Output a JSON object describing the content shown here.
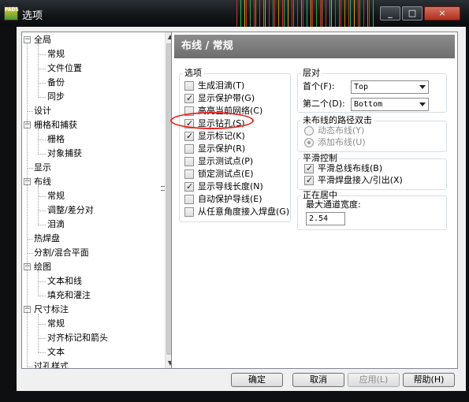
{
  "window": {
    "title": "选项",
    "app_icon_text": "PADS"
  },
  "title_buttons": {
    "minimize": "_",
    "maximize": "□",
    "close": "×"
  },
  "colors": {
    "highlight_circle": "#e8231d",
    "panel_header": "#7d7d7d"
  },
  "tree": {
    "items": [
      {
        "label": "全局",
        "level": 0,
        "expander": "minus"
      },
      {
        "label": "常规",
        "level": 1
      },
      {
        "label": "文件位置",
        "level": 1
      },
      {
        "label": "备份",
        "level": 1
      },
      {
        "label": "同步",
        "level": 1
      },
      {
        "label": "设计",
        "level": 0
      },
      {
        "label": "栅格和捕获",
        "level": 0,
        "expander": "minus"
      },
      {
        "label": "栅格",
        "level": 1
      },
      {
        "label": "对象捕获",
        "level": 1
      },
      {
        "label": "显示",
        "level": 0
      },
      {
        "label": "布线",
        "level": 0,
        "expander": "minus"
      },
      {
        "label": "常规",
        "level": 1
      },
      {
        "label": "调整/差分对",
        "level": 1
      },
      {
        "label": "泪滴",
        "level": 1
      },
      {
        "label": "热焊盘",
        "level": 0
      },
      {
        "label": "分割/混合平面",
        "level": 0
      },
      {
        "label": "绘图",
        "level": 0,
        "expander": "minus"
      },
      {
        "label": "文本和线",
        "level": 1
      },
      {
        "label": "填充和灌注",
        "level": 1
      },
      {
        "label": "尺寸标注",
        "level": 0,
        "expander": "minus"
      },
      {
        "label": "常规",
        "level": 1
      },
      {
        "label": "对齐标记和箭头",
        "level": 1
      },
      {
        "label": "文本",
        "level": 1
      },
      {
        "label": "过孔样式",
        "level": 0
      }
    ]
  },
  "panel": {
    "header": "布线 / 常规"
  },
  "options_group": {
    "title": "选项",
    "items": [
      {
        "label": "生成泪滴(T)",
        "checked": false
      },
      {
        "label": "显示保护带(G)",
        "checked": true
      },
      {
        "label": "高亮当前网络(C)",
        "checked": false
      },
      {
        "label": "显示钻孔(S)",
        "checked": true
      },
      {
        "label": "显示标记(K)",
        "checked": true
      },
      {
        "label": "显示保护(R)",
        "checked": false
      },
      {
        "label": "显示测试点(P)",
        "checked": false
      },
      {
        "label": "锁定测试点(E)",
        "checked": false
      },
      {
        "label": "显示导线长度(N)",
        "checked": true
      },
      {
        "label": "自动保护导线(E)",
        "checked": false
      },
      {
        "label": "从任意角度接入焊盘(G)",
        "checked": false
      }
    ]
  },
  "layer_pair": {
    "title": "层对",
    "first_label": "首个(F):",
    "first_value": "Top",
    "second_label": "第二个(D):",
    "second_value": "Bottom"
  },
  "unrouted_double_click": {
    "title": "未布线的路径双击",
    "options": [
      {
        "label": "动态布线(Y)",
        "selected": false
      },
      {
        "label": "添加布线(U)",
        "selected": true
      }
    ]
  },
  "smoothing": {
    "title": "平滑控制",
    "items": [
      {
        "label": "平滑总线布线(B)",
        "checked": true
      },
      {
        "label": "平滑焊盘接入/引出(X)",
        "checked": true
      }
    ]
  },
  "centering": {
    "title": "正在居中",
    "max_channel_label": "最大通道宽度:",
    "max_channel_value": "2.54"
  },
  "buttons": {
    "ok": "确定",
    "cancel": "取消",
    "apply": "应用(L)",
    "help": "帮助(H)"
  }
}
